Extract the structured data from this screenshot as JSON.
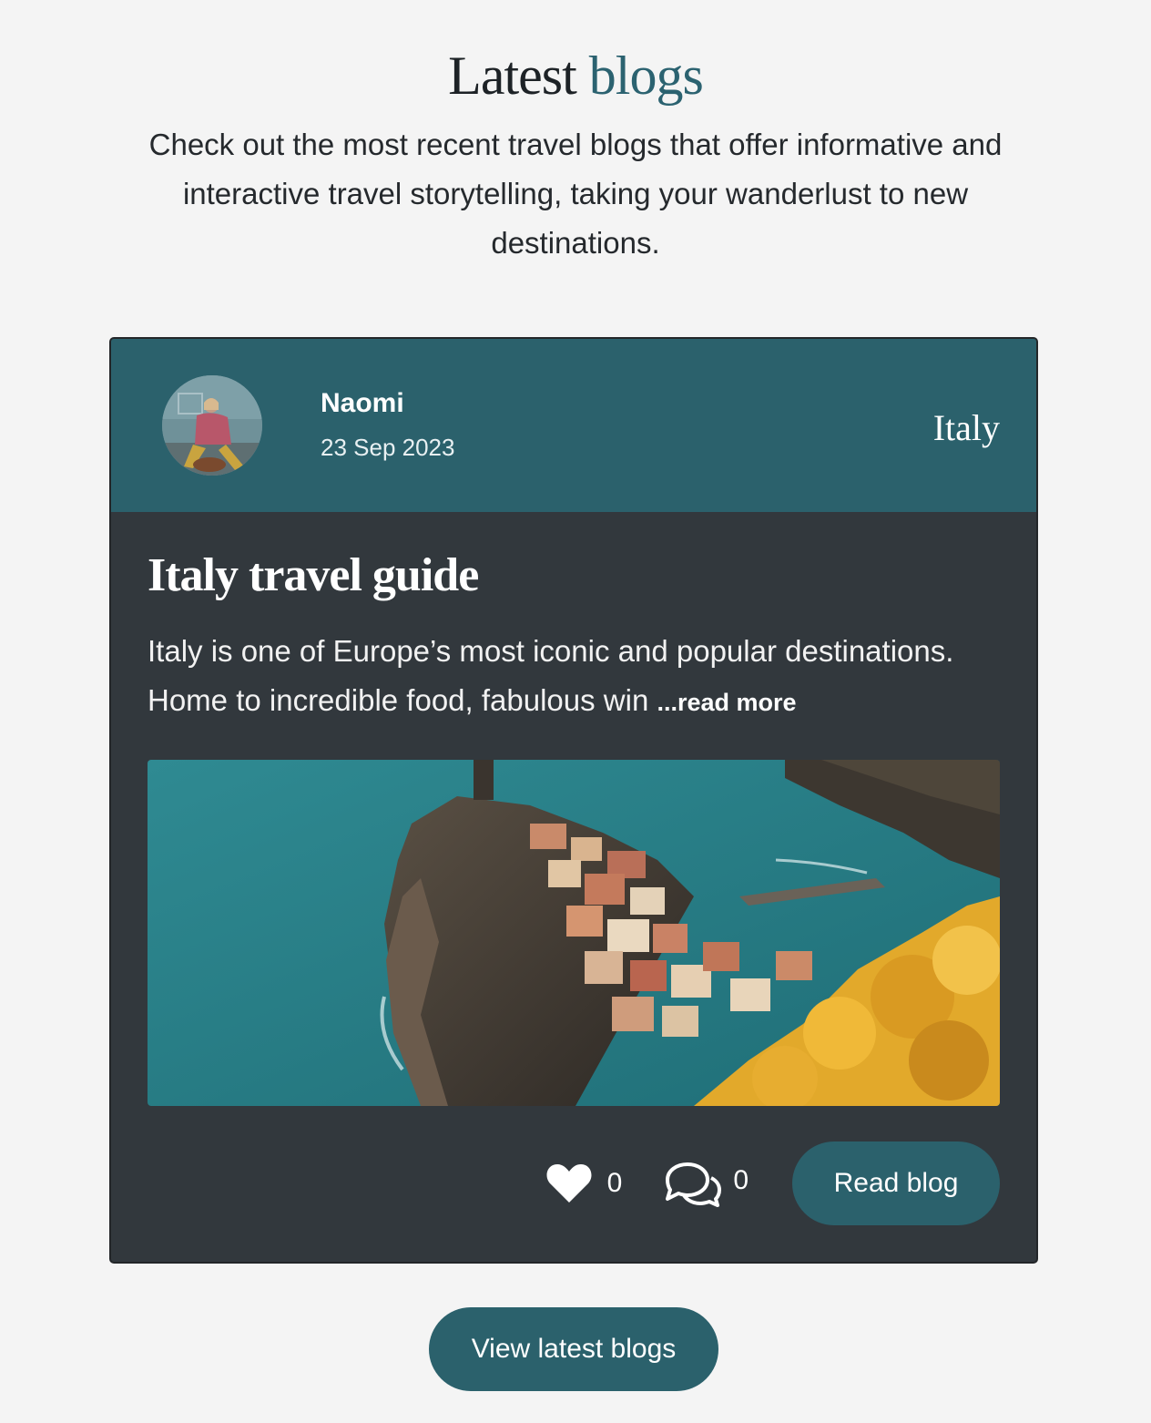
{
  "header": {
    "title_part1": "Latest",
    "title_part2": "blogs",
    "intro": "Check out the most recent travel blogs that offer informative and interactive travel storytelling, taking your wanderlust to new destinations."
  },
  "card": {
    "author": "Naomi",
    "date": "23 Sep 2023",
    "category": "Italy",
    "title": "Italy travel guide",
    "excerpt": "Italy is one of Europe’s most iconic and popular destinations. Home to incredible food, fabulous win ",
    "read_more": "...read more",
    "likes": "0",
    "comments": "0",
    "read_button": "Read blog",
    "icons": {
      "likes": "heart-icon",
      "comments": "comments-icon"
    }
  },
  "view_button": "View latest blogs",
  "colors": {
    "accent": "#2b616c",
    "card_bg": "#32383d",
    "page_bg": "#f4f4f4"
  }
}
